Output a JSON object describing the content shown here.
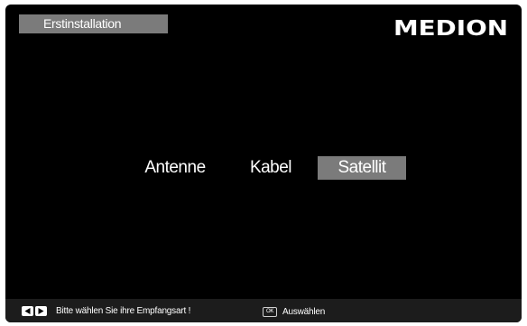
{
  "header": {
    "title": "Erstinstallation",
    "brand": "MEDION"
  },
  "reception_options": {
    "items": [
      {
        "label": "Antenne",
        "selected": false
      },
      {
        "label": "Kabel",
        "selected": false
      },
      {
        "label": "Satellit",
        "selected": true
      }
    ]
  },
  "footer": {
    "nav_icons": [
      "left-arrow-key-icon",
      "right-arrow-key-icon"
    ],
    "hint": "Bitte wählen Sie ihre Empfangsart !",
    "ok_key": "OK",
    "action": "Auswählen"
  },
  "colors": {
    "background": "#000000",
    "highlight": "#7b7b7b",
    "footer": "#1c1c1c",
    "text": "#ffffff"
  }
}
